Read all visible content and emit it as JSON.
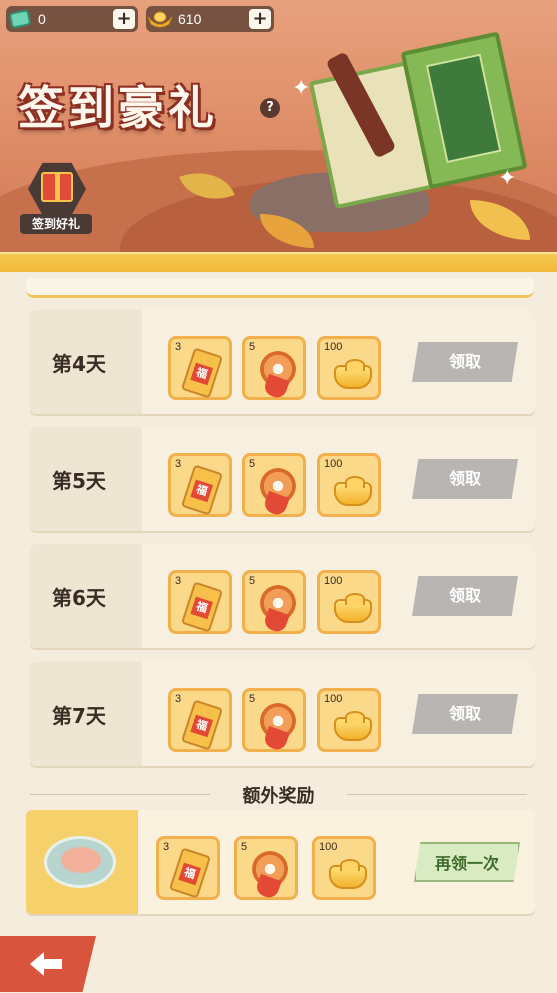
{
  "currency": {
    "ticket_value": "0",
    "gold_value": "610"
  },
  "banner": {
    "title": "签到豪礼",
    "help_glyph": "?",
    "gift_label": "签到好礼"
  },
  "days": [
    {
      "label": "第4天",
      "button": "领取",
      "rewards": [
        {
          "icon": "fortune-ticket-icon",
          "qty": "3",
          "glyph": "福"
        },
        {
          "icon": "flower-ribbon-icon",
          "qty": "5"
        },
        {
          "icon": "gold-ingot-icon",
          "qty": "100"
        }
      ]
    },
    {
      "label": "第5天",
      "button": "领取",
      "rewards": [
        {
          "icon": "fortune-ticket-icon",
          "qty": "3",
          "glyph": "福"
        },
        {
          "icon": "flower-ribbon-icon",
          "qty": "5"
        },
        {
          "icon": "gold-ingot-icon",
          "qty": "100"
        }
      ]
    },
    {
      "label": "第6天",
      "button": "领取",
      "rewards": [
        {
          "icon": "fortune-ticket-icon",
          "qty": "3",
          "glyph": "福"
        },
        {
          "icon": "flower-ribbon-icon",
          "qty": "5"
        },
        {
          "icon": "gold-ingot-icon",
          "qty": "100"
        }
      ]
    },
    {
      "label": "第7天",
      "button": "领取",
      "rewards": [
        {
          "icon": "fortune-ticket-icon",
          "qty": "3",
          "glyph": "福"
        },
        {
          "icon": "flower-ribbon-icon",
          "qty": "5"
        },
        {
          "icon": "gold-ingot-icon",
          "qty": "100"
        }
      ]
    }
  ],
  "bonus": {
    "section_title": "额外奖励",
    "button": "再领一次",
    "rewards": [
      {
        "icon": "fortune-ticket-icon",
        "qty": "3",
        "glyph": "福"
      },
      {
        "icon": "flower-ribbon-icon",
        "qty": "5"
      },
      {
        "icon": "gold-ingot-icon",
        "qty": "100"
      }
    ]
  },
  "colors": {
    "claim_disabled": "#b8b5b2",
    "claim_again": "#d9ebc2",
    "banner_accent": "#f5c94e",
    "back_button": "#d9543d"
  }
}
